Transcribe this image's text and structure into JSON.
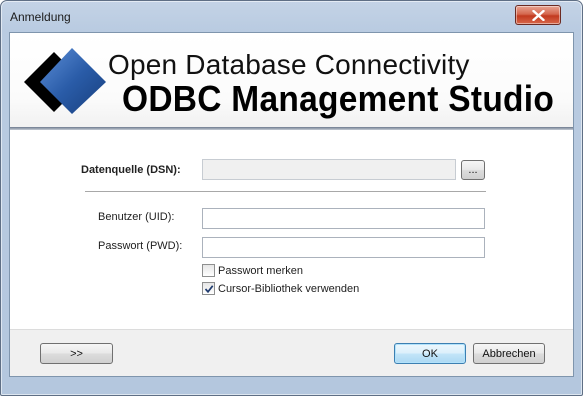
{
  "window": {
    "title": "Anmeldung"
  },
  "banner": {
    "subtitle": "Open Database Connectivity",
    "title": "ODBC Management Studio"
  },
  "form": {
    "dsn_label": "Datenquelle (DSN):",
    "dsn_value": "",
    "browse_label": "...",
    "uid_label": "Benutzer (UID):",
    "uid_value": "",
    "pwd_label": "Passwort (PWD):",
    "pwd_value": "",
    "remember_label": "Passwort merken",
    "remember_checked": false,
    "cursor_label": "Cursor-Bibliothek verwenden",
    "cursor_checked": true
  },
  "buttons": {
    "more_label": ">>",
    "ok_label": "OK",
    "cancel_label": "Abbrechen"
  },
  "colors": {
    "logo_blue": "#2a5ca8",
    "default_button_border": "#3c7fb1",
    "close_button_red": "#c23a1f"
  },
  "icons": {
    "close": "close-icon",
    "logo": "odbc-logo",
    "check": "check-icon"
  }
}
